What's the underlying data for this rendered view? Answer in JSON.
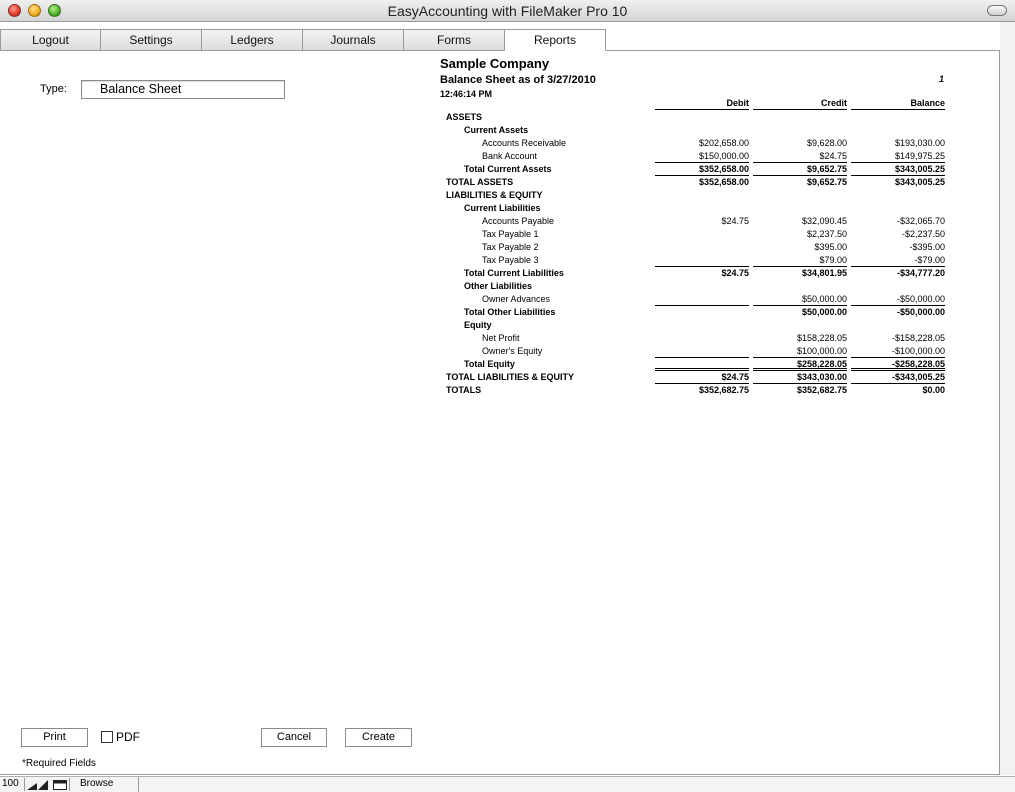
{
  "window": {
    "title": "EasyAccounting with FileMaker Pro 10"
  },
  "tabs": [
    {
      "label": "Logout",
      "active": false
    },
    {
      "label": "Settings",
      "active": false
    },
    {
      "label": "Ledgers",
      "active": false
    },
    {
      "label": "Journals",
      "active": false
    },
    {
      "label": "Forms",
      "active": false
    },
    {
      "label": "Reports",
      "active": true
    }
  ],
  "form": {
    "type_label": "Type:",
    "type_value": "Balance Sheet"
  },
  "report": {
    "company": "Sample Company",
    "subtitle": "Balance Sheet as of 3/27/2010",
    "time": "12:46:14 PM",
    "page": "1",
    "columns": [
      "Debit",
      "Credit",
      "Balance"
    ],
    "rows": [
      {
        "label": "ASSETS",
        "level": 0,
        "bold": true,
        "debit": "",
        "credit": "",
        "balance": ""
      },
      {
        "label": "Current Assets",
        "level": 1,
        "bold": true,
        "debit": "",
        "credit": "",
        "balance": ""
      },
      {
        "label": "Accounts Receivable",
        "level": 2,
        "bold": false,
        "debit": "$202,658.00",
        "credit": "$9,628.00",
        "balance": "$193,030.00"
      },
      {
        "label": "Bank Account",
        "level": 2,
        "bold": false,
        "debit": "$150,000.00",
        "credit": "$24.75",
        "balance": "$149,975.25",
        "rule": "single"
      },
      {
        "label": "Total Current Assets",
        "level": 1,
        "bold": true,
        "debit": "$352,658.00",
        "credit": "$9,652.75",
        "balance": "$343,005.25",
        "rule": "single"
      },
      {
        "label": "TOTAL ASSETS",
        "level": 0,
        "bold": true,
        "debit": "$352,658.00",
        "credit": "$9,652.75",
        "balance": "$343,005.25"
      },
      {
        "label": "LIABILITIES & EQUITY",
        "level": 0,
        "bold": true,
        "debit": "",
        "credit": "",
        "balance": ""
      },
      {
        "label": "Current Liabilities",
        "level": 1,
        "bold": true,
        "debit": "",
        "credit": "",
        "balance": ""
      },
      {
        "label": "Accounts Payable",
        "level": 2,
        "bold": false,
        "debit": "$24.75",
        "credit": "$32,090.45",
        "balance": "-$32,065.70"
      },
      {
        "label": "Tax Payable 1",
        "level": 2,
        "bold": false,
        "debit": "",
        "credit": "$2,237.50",
        "balance": "-$2,237.50"
      },
      {
        "label": "Tax Payable 2",
        "level": 2,
        "bold": false,
        "debit": "",
        "credit": "$395.00",
        "balance": "-$395.00"
      },
      {
        "label": "Tax Payable 3",
        "level": 2,
        "bold": false,
        "debit": "",
        "credit": "$79.00",
        "balance": "-$79.00",
        "rule": "single"
      },
      {
        "label": "Total Current Liabilities",
        "level": 1,
        "bold": true,
        "debit": "$24.75",
        "credit": "$34,801.95",
        "balance": "-$34,777.20"
      },
      {
        "label": "Other Liabilities",
        "level": 1,
        "bold": true,
        "debit": "",
        "credit": "",
        "balance": ""
      },
      {
        "label": "Owner Advances",
        "level": 2,
        "bold": false,
        "debit": "",
        "credit": "$50,000.00",
        "balance": "-$50,000.00",
        "rule": "single"
      },
      {
        "label": "Total Other Liabilities",
        "level": 1,
        "bold": true,
        "debit": "",
        "credit": "$50,000.00",
        "balance": "-$50,000.00"
      },
      {
        "label": "Equity",
        "level": 1,
        "bold": true,
        "debit": "",
        "credit": "",
        "balance": ""
      },
      {
        "label": "Net Profit",
        "level": 2,
        "bold": false,
        "debit": "",
        "credit": "$158,228.05",
        "balance": "-$158,228.05"
      },
      {
        "label": "Owner's Equity",
        "level": 2,
        "bold": false,
        "debit": "",
        "credit": "$100,000.00",
        "balance": "-$100,000.00",
        "rule": "single"
      },
      {
        "label": "Total Equity",
        "level": 1,
        "bold": true,
        "debit": "",
        "credit": "$258,228.05",
        "balance": "-$258,228.05",
        "rule": "double"
      },
      {
        "label": "TOTAL LIABILITIES & EQUITY",
        "level": 0,
        "bold": true,
        "debit": "$24.75",
        "credit": "$343,030.00",
        "balance": "-$343,005.25",
        "rule": "single"
      },
      {
        "label": "TOTALS",
        "level": 0,
        "bold": true,
        "debit": "$352,682.75",
        "credit": "$352,682.75",
        "balance": "$0.00"
      }
    ]
  },
  "buttons": {
    "print": "Print",
    "pdf": "PDF",
    "cancel": "Cancel",
    "create": "Create"
  },
  "pdf_checked": false,
  "required_note": "*Required Fields",
  "status": {
    "zoom": "100",
    "mode": "Browse"
  }
}
